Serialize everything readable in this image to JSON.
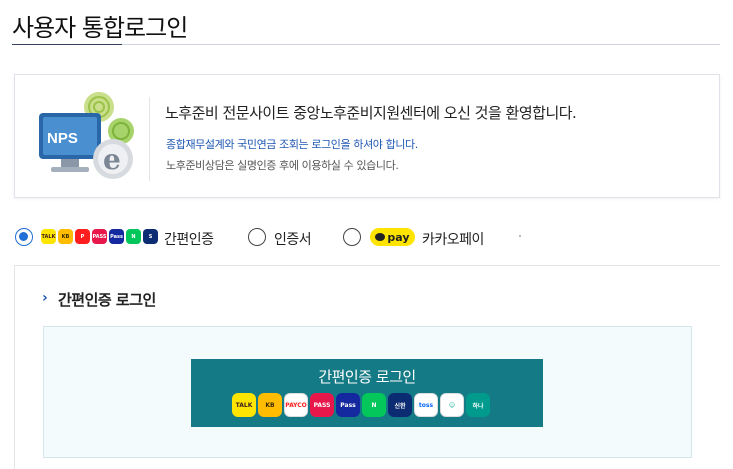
{
  "page": {
    "title": "사용자 통합로그인"
  },
  "welcome": {
    "logo_text": "NPS",
    "heading": "노후준비 전문사이트 중앙노후준비지원센터에 오신 것을 환영합니다.",
    "notice": "종합재무설계와 국민연금 조회는 로그인을 하셔야 합니다.",
    "subtext": "노후준비상담은 실명인증 후에 이용하실 수 있습니다."
  },
  "login_options": {
    "selected": "easy_auth",
    "options": [
      {
        "id": "easy_auth",
        "label": "간편인증",
        "checked": true
      },
      {
        "id": "certificate",
        "label": "인증서",
        "checked": false
      },
      {
        "id": "kakaopay",
        "label": "카카오페이",
        "checked": false
      }
    ],
    "kakaopay_badge": "pay",
    "mini_icons": [
      {
        "name": "kakao-icon",
        "bg": "#fee500",
        "fg": "#3c1e1e",
        "text": "TALK"
      },
      {
        "name": "kb-icon",
        "bg": "#ffbc00",
        "fg": "#3a2a00",
        "text": "KB"
      },
      {
        "name": "payco-icon",
        "bg": "#ff1e1e",
        "fg": "#ffffff",
        "text": "P"
      },
      {
        "name": "pass-icon",
        "bg": "#e8174b",
        "fg": "#ffffff",
        "text": "PASS"
      },
      {
        "name": "samsung-pass-icon",
        "bg": "#1428a0",
        "fg": "#ffffff",
        "text": "Pass"
      },
      {
        "name": "naver-icon",
        "bg": "#03c75a",
        "fg": "#ffffff",
        "text": "N"
      },
      {
        "name": "shinhan-icon",
        "bg": "#0b2c72",
        "fg": "#ffffff",
        "text": "S"
      }
    ]
  },
  "easy_login": {
    "section_chevron": "›",
    "section_title": "간편인증 로그인",
    "button_label": "간편인증 로그인",
    "providers": [
      {
        "name": "kakao-provider-icon",
        "bg": "#fee500",
        "fg": "#3c1e1e",
        "text": "TALK"
      },
      {
        "name": "kb-provider-icon",
        "bg": "#ffbc00",
        "fg": "#3a2a00",
        "text": "KB"
      },
      {
        "name": "payco-provider-icon",
        "bg": "#ffffff",
        "fg": "#ff1e1e",
        "text": "PAYCO"
      },
      {
        "name": "pass-provider-icon",
        "bg": "#e8174b",
        "fg": "#ffffff",
        "text": "PASS"
      },
      {
        "name": "samsung-pass-provider-icon",
        "bg": "#1428a0",
        "fg": "#ffffff",
        "text": "Pass"
      },
      {
        "name": "naver-provider-icon",
        "bg": "#03c75a",
        "fg": "#ffffff",
        "text": "N"
      },
      {
        "name": "shinhan-provider-icon",
        "bg": "#0b2c72",
        "fg": "#ffffff",
        "text": "신한"
      },
      {
        "name": "toss-provider-icon",
        "bg": "#ffffff",
        "fg": "#0064ff",
        "text": "toss"
      },
      {
        "name": "smile-provider-icon",
        "bg": "#ffffff",
        "fg": "#19b394",
        "text": "☺"
      },
      {
        "name": "hana-provider-icon",
        "bg": "#009b8d",
        "fg": "#ffffff",
        "text": "하나"
      }
    ]
  },
  "colors": {
    "accent_blue": "#1f6fd6",
    "button_teal": "#147a86",
    "notice_blue": "#1f57b3",
    "kakaopay_yellow": "#ffe400"
  }
}
